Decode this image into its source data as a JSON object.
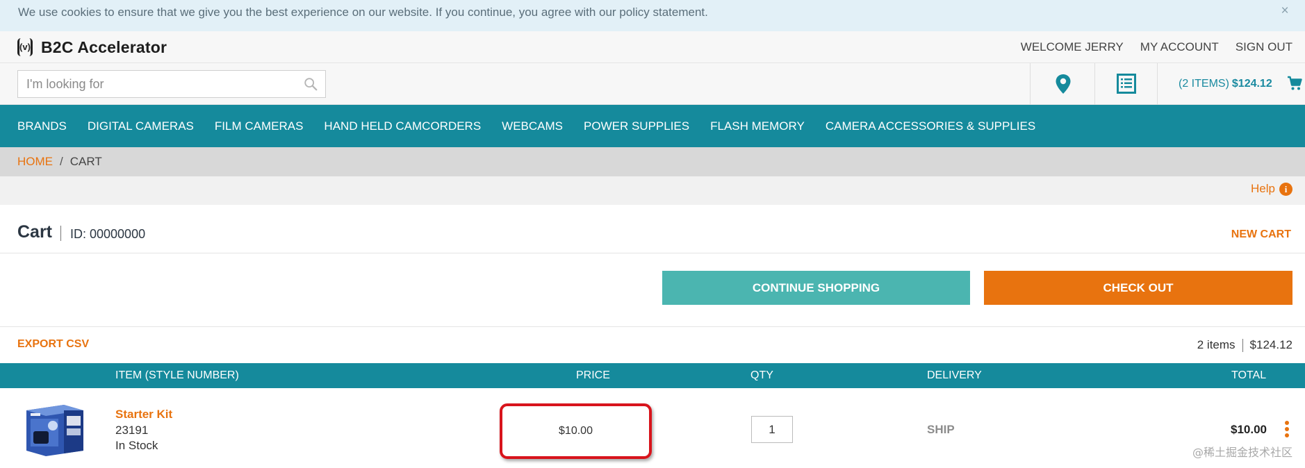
{
  "cookie": {
    "message": "We use cookies to ensure that we give you the best experience on our website. If you continue, you agree with our policy statement.",
    "close": "×"
  },
  "header": {
    "logo_mark": "(v)",
    "logo_text": "B2C Accelerator",
    "welcome": "WELCOME JERRY",
    "my_account": "MY ACCOUNT",
    "sign_out": "SIGN OUT"
  },
  "search": {
    "placeholder": "I'm looking for",
    "value": ""
  },
  "utility": {
    "location_icon": "map-pin-icon",
    "list_icon": "list-icon",
    "cart_count": "(2 ITEMS)",
    "cart_total": "$124.12",
    "cart_icon": "shopping-cart-icon"
  },
  "nav": {
    "items": [
      "BRANDS",
      "DIGITAL CAMERAS",
      "FILM CAMERAS",
      "HAND HELD CAMCORDERS",
      "WEBCAMS",
      "POWER SUPPLIES",
      "FLASH MEMORY",
      "CAMERA ACCESSORIES & SUPPLIES"
    ]
  },
  "breadcrumb": {
    "home": "HOME",
    "separator": "/",
    "current": "CART"
  },
  "help": {
    "label": "Help",
    "icon": "i"
  },
  "cart": {
    "title": "Cart",
    "id": "ID: 00000000",
    "new_cart": "NEW CART",
    "continue_shopping": "CONTINUE SHOPPING",
    "check_out": "CHECK OUT",
    "export_csv": "EXPORT CSV",
    "summary_items": "2 items",
    "summary_total": "$124.12"
  },
  "table": {
    "headers": {
      "item": "ITEM (STYLE NUMBER)",
      "price": "PRICE",
      "qty": "QTY",
      "delivery": "DELIVERY",
      "total": "TOTAL"
    },
    "rows": [
      {
        "name": "Starter Kit",
        "sku": "23191",
        "stock": "In Stock",
        "price": "$10.00",
        "qty": "1",
        "delivery": "SHIP",
        "total": "$10.00"
      }
    ]
  },
  "colors": {
    "teal": "#158a9c",
    "orange": "#e8730f",
    "continue": "#4bb5b0",
    "highlight": "#d8141c"
  },
  "watermark": "@稀土掘金技术社区"
}
